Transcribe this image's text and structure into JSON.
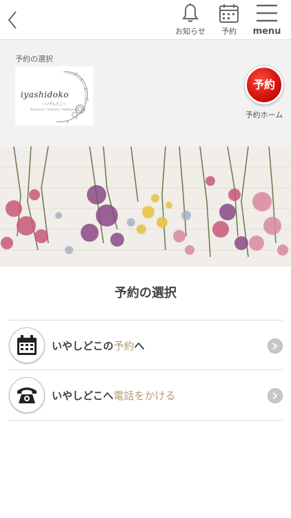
{
  "topbar": {
    "notifications_label": "お知らせ",
    "reserve_label": "予約",
    "menu_label": "menu"
  },
  "header": {
    "label": "予約の選択",
    "logo_text": "iyashidoko",
    "logo_sub": "—いやしどこ—",
    "logo_small": "Relaxation / Aromatic / Reflexology",
    "reserve_button_text": "予約",
    "reserve_home_label": "予約ホーム"
  },
  "main": {
    "title": "予約の選択",
    "rows": [
      {
        "text_strong": "いやしどこの",
        "text_accent": "予約",
        "text_suffix": "へ",
        "icon": "calendar-icon"
      },
      {
        "text_strong": "いやしどこへ",
        "text_accent": "電話をかける",
        "text_suffix": "",
        "icon": "phone-icon"
      }
    ]
  },
  "colors": {
    "accent": "#b49a72",
    "reserve_red": "#d4140c",
    "header_bg": "#f2f2f2"
  }
}
